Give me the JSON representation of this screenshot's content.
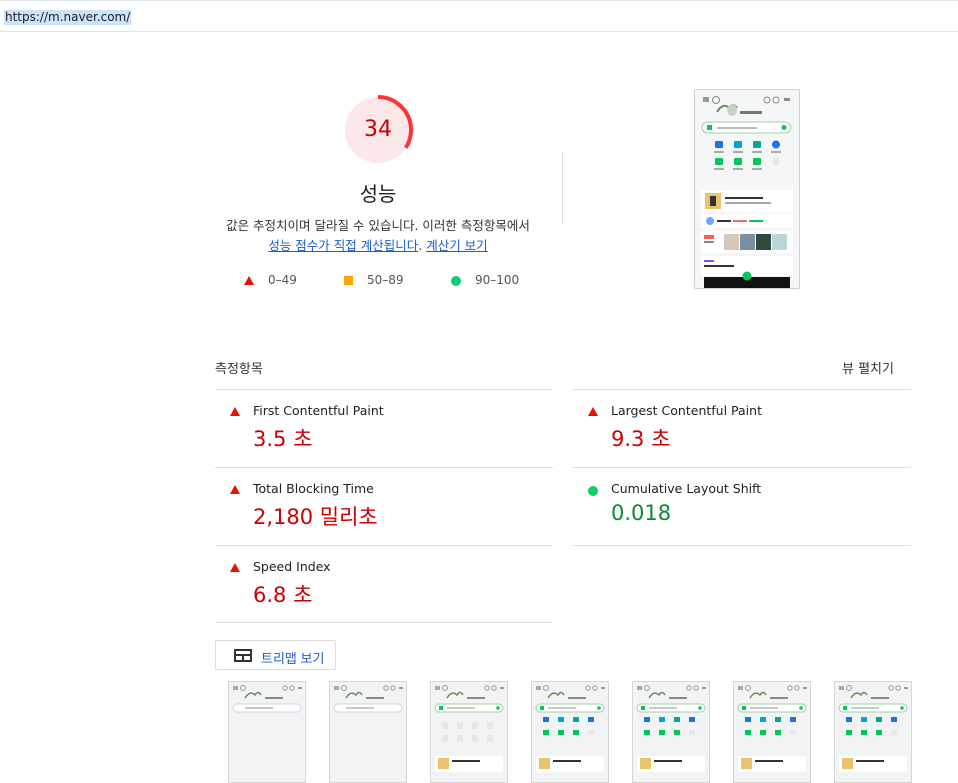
{
  "address_bar": {
    "url": "https://m.naver.com/"
  },
  "score": {
    "value": "34",
    "fraction": 0.34,
    "title": "성능",
    "color": "#ff3333"
  },
  "description": {
    "text": "값은 추정치이며 달라질 수 있습니다. 이러한 측정항목에서",
    "link1": "성능 점수가 직접 계산됩니다",
    "link2": "계산기 보기"
  },
  "legend": [
    {
      "range": "0–49",
      "shape": "triangle",
      "color": "#eb0f00"
    },
    {
      "range": "50–89",
      "shape": "square",
      "color": "#ffa400"
    },
    {
      "range": "90–100",
      "shape": "circle",
      "color": "#0cce6b"
    }
  ],
  "metrics_section": {
    "heading": "측정항목",
    "expand_label": "뷰 펼치기",
    "items": [
      {
        "name": "First Contentful Paint",
        "value": "3.5 초",
        "status": "fail"
      },
      {
        "name": "Largest Contentful Paint",
        "value": "9.3 초",
        "status": "fail"
      },
      {
        "name": "Total Blocking Time",
        "value": "2,180 밀리초",
        "status": "fail"
      },
      {
        "name": "Cumulative Layout Shift",
        "value": "0.018",
        "status": "pass"
      },
      {
        "name": "Speed Index",
        "value": "6.8 초",
        "status": "fail"
      }
    ]
  },
  "treemap_button": {
    "label": "트리맵 보기"
  },
  "filmstrip": {
    "frame_count": 7
  }
}
